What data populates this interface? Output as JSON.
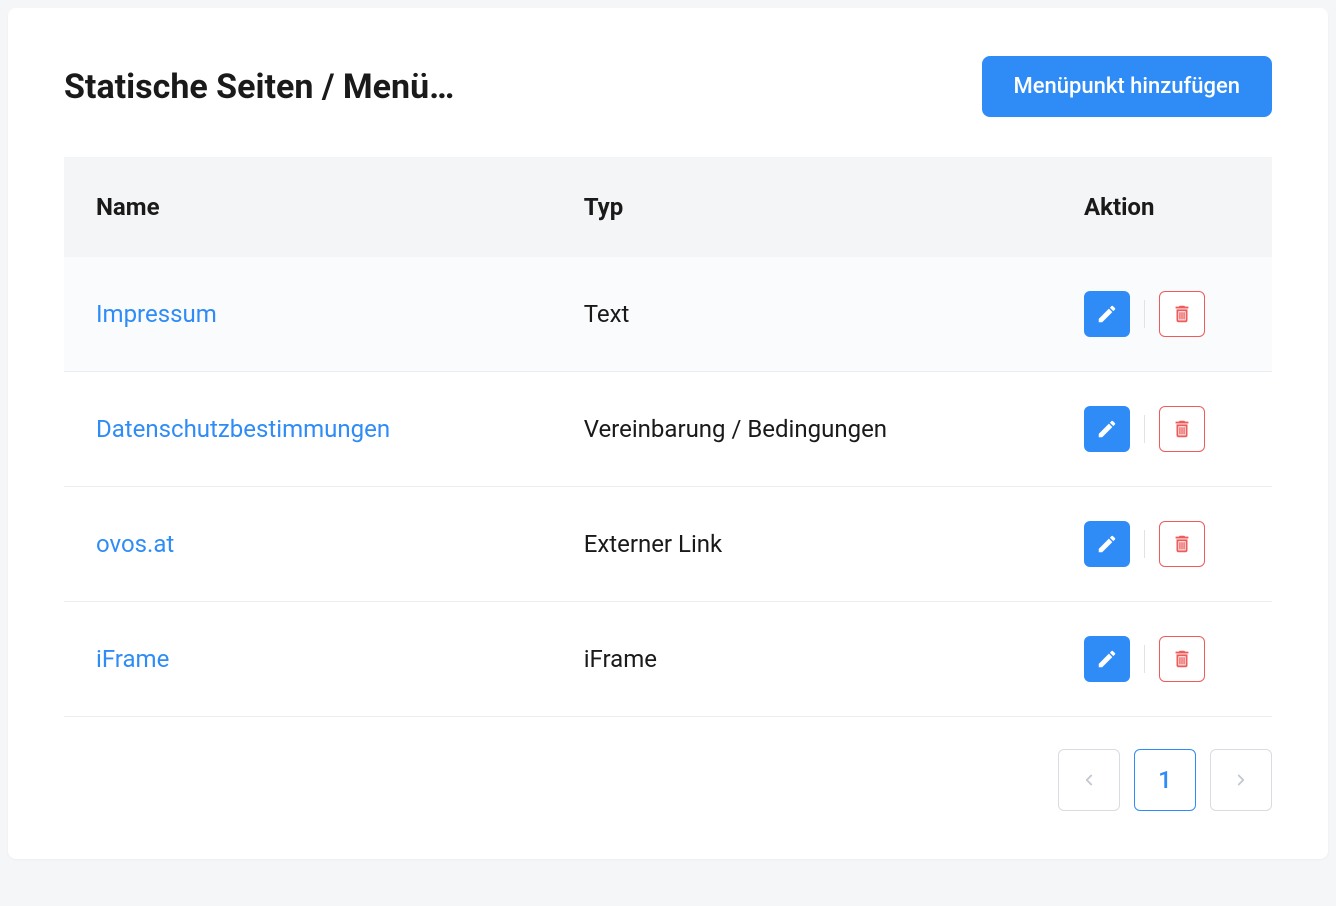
{
  "page": {
    "title": "Statische Seiten / Menü…",
    "add_button_label": "Menüpunkt hinzufügen"
  },
  "table": {
    "columns": {
      "name": "Name",
      "type": "Typ",
      "action": "Aktion"
    },
    "rows": [
      {
        "name": "Impressum",
        "type": "Text"
      },
      {
        "name": "Datenschutzbestimmungen",
        "type": "Vereinbarung / Bedingungen"
      },
      {
        "name": "ovos.at",
        "type": "Externer Link"
      },
      {
        "name": "iFrame",
        "type": "iFrame"
      }
    ]
  },
  "pagination": {
    "current": "1"
  },
  "icons": {
    "edit": "pencil-icon",
    "delete": "trash-icon",
    "prev": "chevron-left-icon",
    "next": "chevron-right-icon"
  },
  "colors": {
    "primary": "#2f8cf7",
    "danger": "#ee5b5b",
    "text": "#1a1a1a",
    "border": "#d9dce0"
  }
}
